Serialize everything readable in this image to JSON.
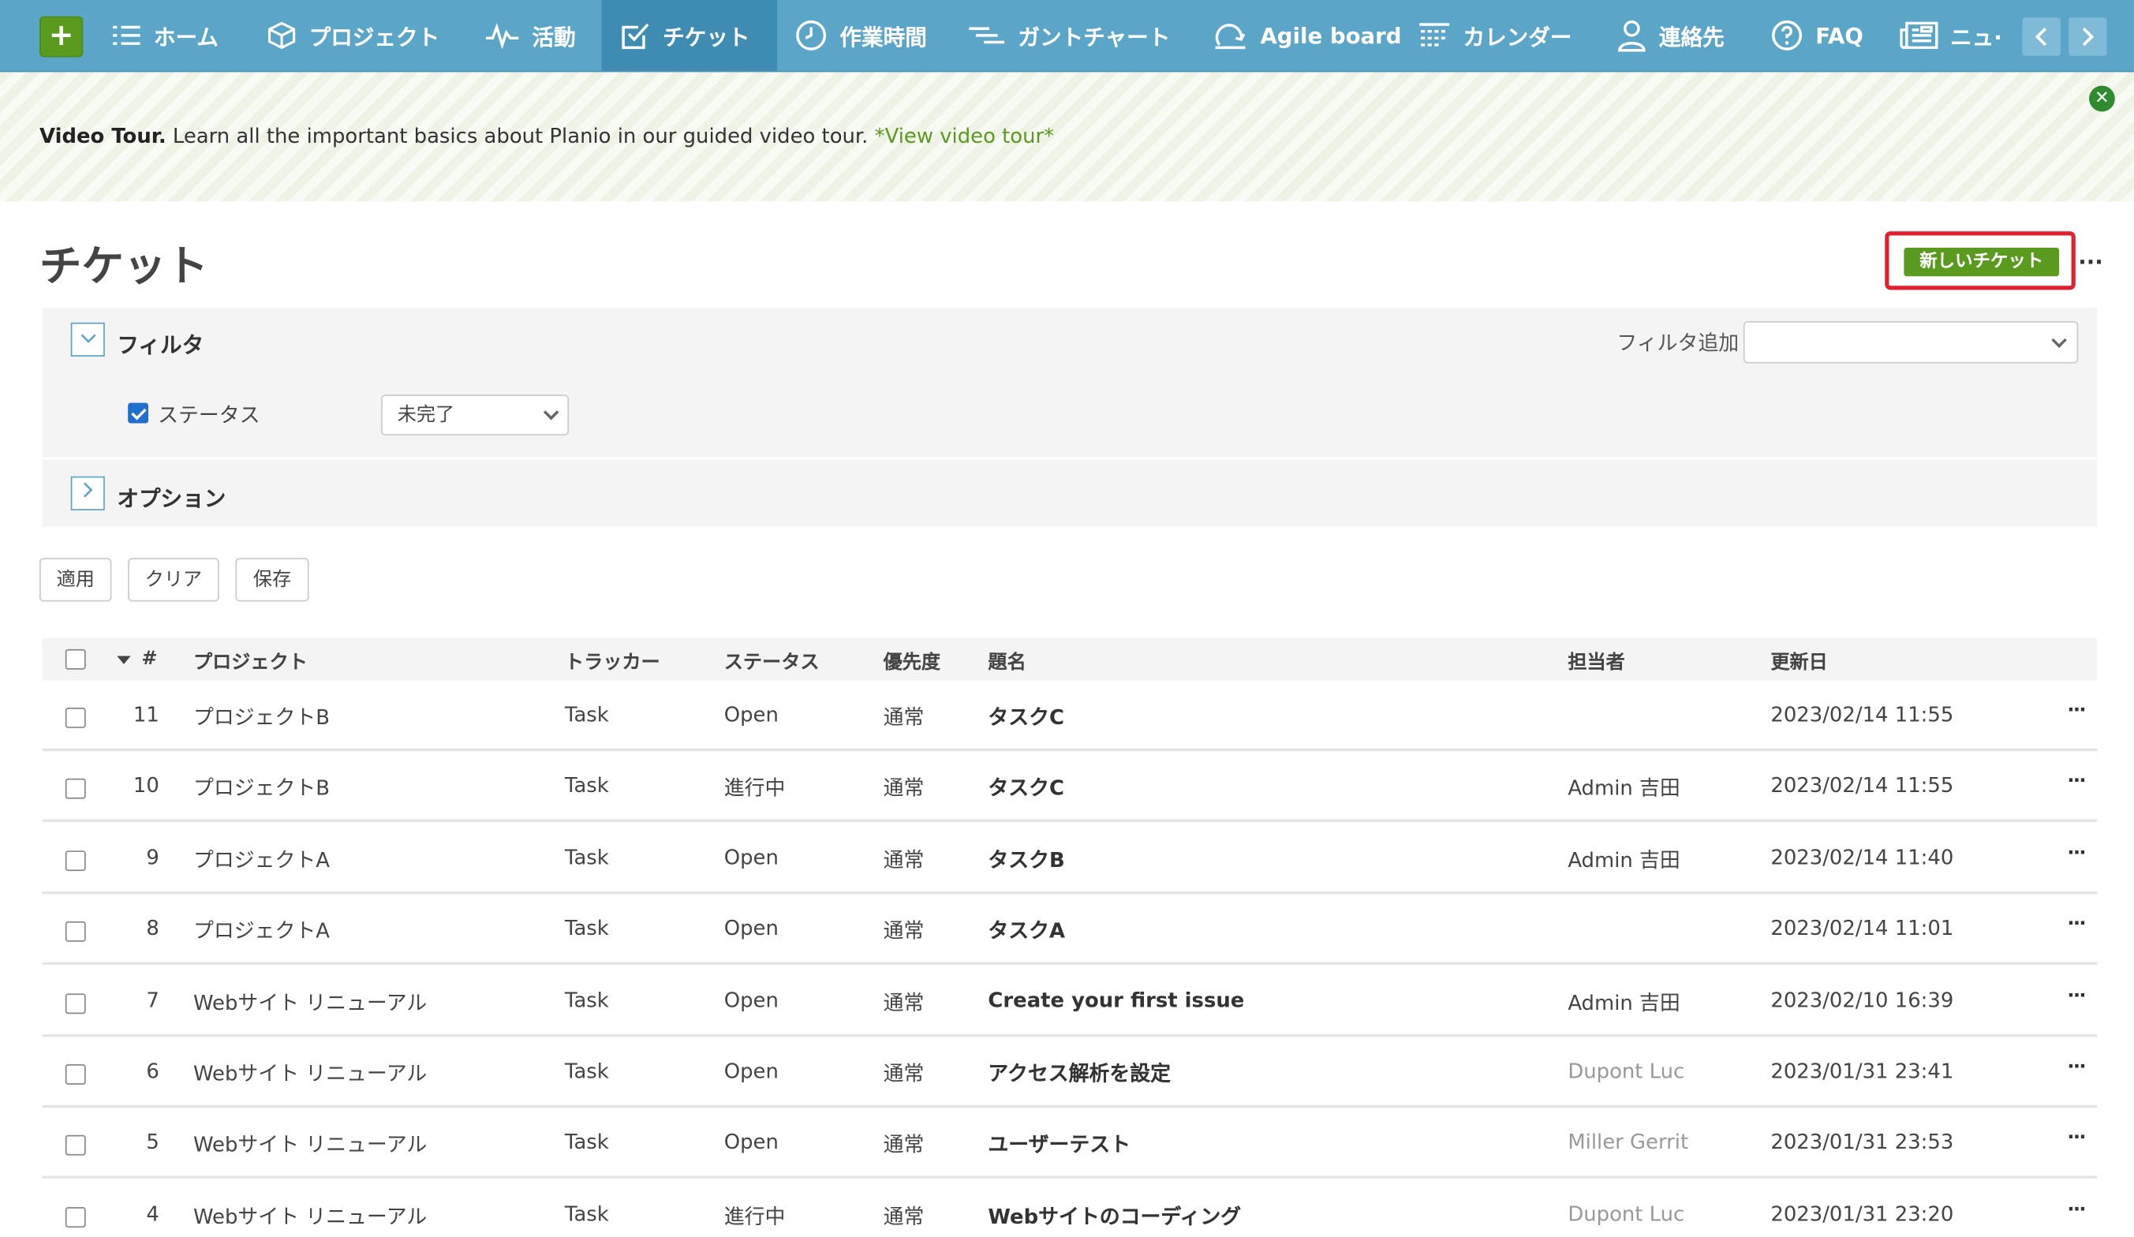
{
  "nav": {
    "items": [
      {
        "label": "ホーム",
        "icon": "list-icon"
      },
      {
        "label": "プロジェクト",
        "icon": "cube-icon"
      },
      {
        "label": "活動",
        "icon": "activity-icon"
      },
      {
        "label": "チケット",
        "icon": "checkbox-icon",
        "active": true
      },
      {
        "label": "作業時間",
        "icon": "clock-icon"
      },
      {
        "label": "ガントチャート",
        "icon": "gantt-icon"
      },
      {
        "label": "Agile board",
        "icon": "agile-icon"
      },
      {
        "label": "カレンダー",
        "icon": "calendar-icon"
      },
      {
        "label": "連絡先",
        "icon": "person-icon"
      },
      {
        "label": "FAQ",
        "icon": "question-icon"
      },
      {
        "label": "ニュ·",
        "icon": "news-icon"
      }
    ]
  },
  "banner": {
    "title": "Video Tour.",
    "text": " Learn all the important basics about Planio in our guided video tour. ",
    "link": "*View video tour*"
  },
  "page": {
    "title": "チケット",
    "new_ticket": "新しいチケット",
    "more": "···"
  },
  "filters": {
    "section_label": "フィルタ",
    "add_filter_label": "フィルタ追加",
    "status_label": "ステータス",
    "status_value": "未完了",
    "options_label": "オプション"
  },
  "actions": {
    "apply": "適用",
    "clear": "クリア",
    "save": "保存"
  },
  "table": {
    "headers": {
      "id": "#",
      "project": "プロジェクト",
      "tracker": "トラッカー",
      "status": "ステータス",
      "priority": "優先度",
      "subject": "題名",
      "assignee": "担当者",
      "updated": "更新日"
    },
    "rows": [
      {
        "id": "11",
        "project": "プロジェクトB",
        "tracker": "Task",
        "status": "Open",
        "priority": "通常",
        "subject": "タスクC",
        "assignee": "",
        "updated": "2023/02/14 11:55"
      },
      {
        "id": "10",
        "project": "プロジェクトB",
        "tracker": "Task",
        "status": "進行中",
        "priority": "通常",
        "subject": "タスクC",
        "assignee": "Admin 吉田",
        "updated": "2023/02/14 11:55"
      },
      {
        "id": "9",
        "project": "プロジェクトA",
        "tracker": "Task",
        "status": "Open",
        "priority": "通常",
        "subject": "タスクB",
        "assignee": "Admin 吉田",
        "updated": "2023/02/14 11:40"
      },
      {
        "id": "8",
        "project": "プロジェクトA",
        "tracker": "Task",
        "status": "Open",
        "priority": "通常",
        "subject": "タスクA",
        "assignee": "",
        "updated": "2023/02/14 11:01"
      },
      {
        "id": "7",
        "project": "Webサイト リニューアル",
        "tracker": "Task",
        "status": "Open",
        "priority": "通常",
        "subject": "Create your first issue",
        "assignee": "Admin 吉田",
        "updated": "2023/02/10 16:39"
      },
      {
        "id": "6",
        "project": "Webサイト リニューアル",
        "tracker": "Task",
        "status": "Open",
        "priority": "通常",
        "subject": "アクセス解析を設定",
        "assignee": "Dupont Luc",
        "assignee_dim": true,
        "updated": "2023/01/31 23:41"
      },
      {
        "id": "5",
        "project": "Webサイト リニューアル",
        "tracker": "Task",
        "status": "Open",
        "priority": "通常",
        "subject": "ユーザーテスト",
        "assignee": "Miller Gerrit",
        "assignee_dim": true,
        "updated": "2023/01/31 23:53"
      },
      {
        "id": "4",
        "project": "Webサイト リニューアル",
        "tracker": "Task",
        "status": "進行中",
        "priority": "通常",
        "subject": "Webサイトのコーディング",
        "assignee": "Dupont Luc",
        "assignee_dim": true,
        "updated": "2023/01/31 23:20"
      }
    ],
    "row_more": "···"
  },
  "colors": {
    "nav_bg": "#5ba6c8",
    "nav_active": "#3e8cb1",
    "primary_green": "#5a9a1e",
    "highlight_red": "#e0202f"
  }
}
